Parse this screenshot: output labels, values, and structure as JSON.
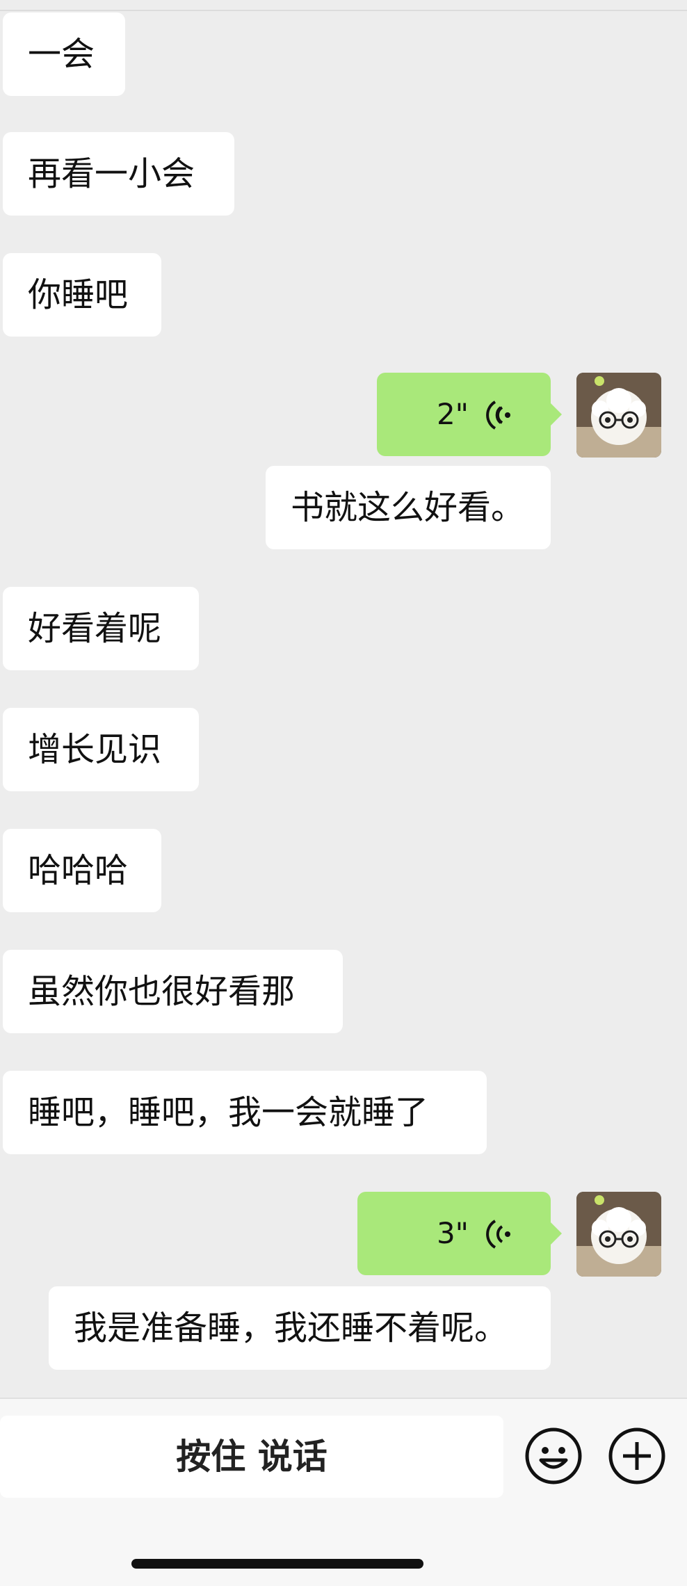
{
  "messages": {
    "m1": "一会",
    "m2": "再看一小会",
    "m3": "你睡吧",
    "v1_duration": "2\"",
    "m4": "书就这么好看。",
    "m5": "好看着呢",
    "m6": "增长见识",
    "m7": "哈哈哈",
    "m8": "虽然你也很好看那",
    "m9": "睡吧，睡吧，我一会就睡了",
    "v2_duration": "3\"",
    "m10": "我是准备睡，我还睡不着呢。"
  },
  "input_bar": {
    "talk_label": "按住 说话"
  },
  "colors": {
    "voice_bubble": "#a9e87a",
    "bubble": "#ffffff",
    "background": "#ededed"
  },
  "icons": [
    "voice-wave-icon",
    "emoji-icon",
    "plus-icon"
  ]
}
